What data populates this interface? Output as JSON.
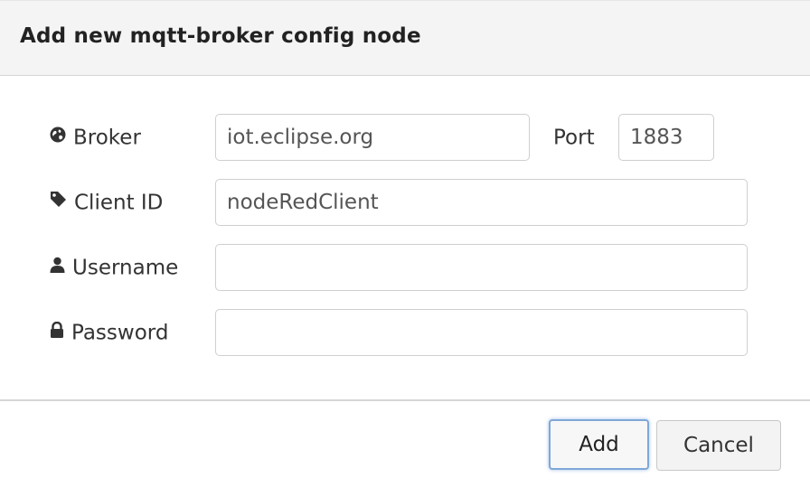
{
  "dialog": {
    "title": "Add new mqtt-broker config node"
  },
  "form": {
    "broker": {
      "label": "Broker",
      "icon": "globe-icon",
      "value": "iot.eclipse.org"
    },
    "port": {
      "label": "Port",
      "value": "1883"
    },
    "client_id": {
      "label": "Client ID",
      "icon": "tag-icon",
      "value": "nodeRedClient"
    },
    "username": {
      "label": "Username",
      "icon": "user-icon",
      "value": ""
    },
    "password": {
      "label": "Password",
      "icon": "lock-icon",
      "value": ""
    }
  },
  "footer": {
    "add_label": "Add",
    "cancel_label": "Cancel"
  },
  "colors": {
    "titlebar_bg": "#f4f4f4",
    "primary_focus_border": "#7fa8d8"
  }
}
